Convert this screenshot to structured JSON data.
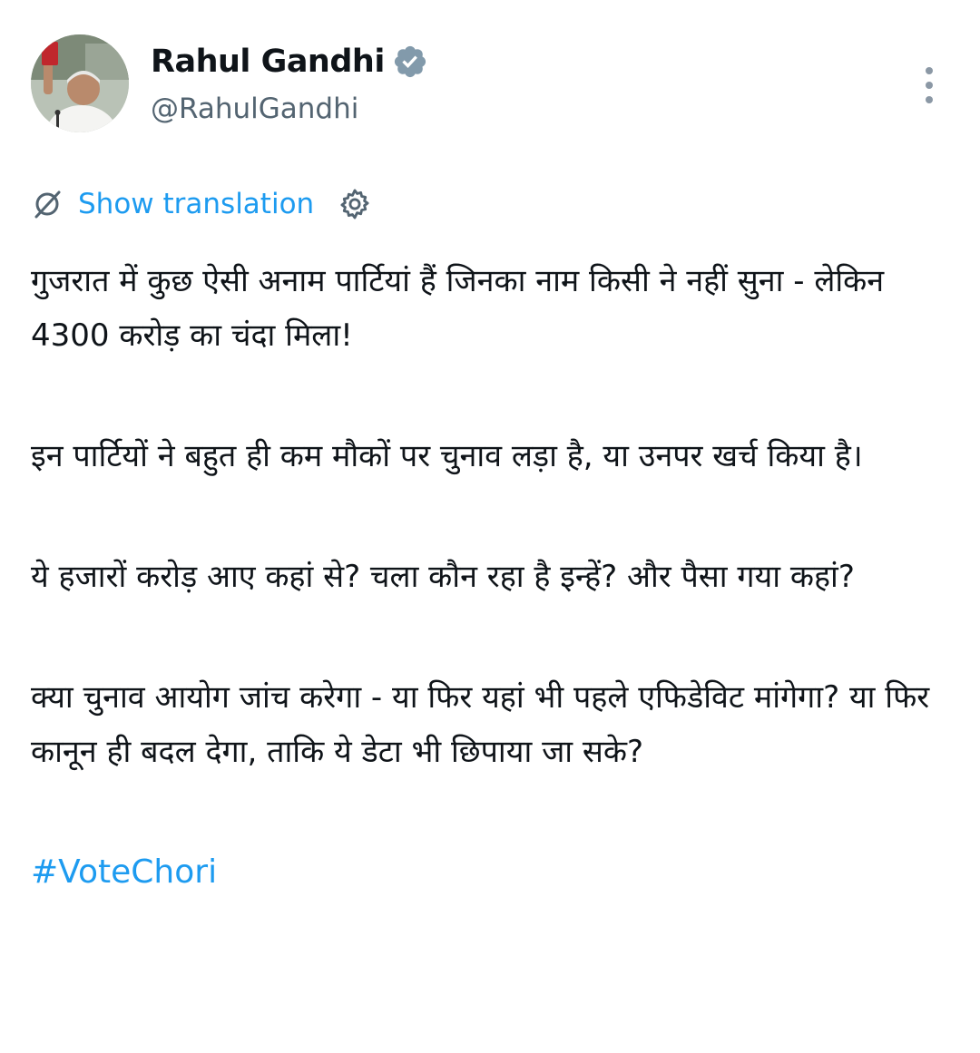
{
  "author": {
    "display_name": "Rahul Gandhi",
    "handle": "@RahulGandhi",
    "avatar_icon": "profile-photo",
    "verified_icon": "verified-badge-icon"
  },
  "actions": {
    "more_icon": "vertical-ellipsis-icon"
  },
  "translation": {
    "link_label": "Show translation",
    "icon": "translate-icon",
    "settings_icon": "gear-icon"
  },
  "tweet": {
    "paragraphs": [
      "गुजरात में कुछ ऐसी अनाम पार्टियां हैं जिनका नाम किसी ने नहीं सुना - लेकिन 4300 करोड़ का चंदा मिला!",
      "इन पार्टियों ने बहुत ही कम मौकों पर चुनाव लड़ा है, या उनपर खर्च किया है।",
      "ये हजारों करोड़ आए कहां से? चला कौन रहा है इन्हें? और पैसा गया कहां?",
      "क्या चुनाव आयोग जांच करेगा - या फिर यहां भी पहले एफिडेविट मांगेगा? या फिर कानून ही बदल देगा, ताकि ये डेटा भी छिपाया जा सके?"
    ],
    "hashtag": "#VoteChori"
  },
  "colors": {
    "link_blue": "#1d9bf0",
    "secondary_text": "#536471",
    "primary_text": "#0f1419",
    "background": "#ffffff"
  }
}
